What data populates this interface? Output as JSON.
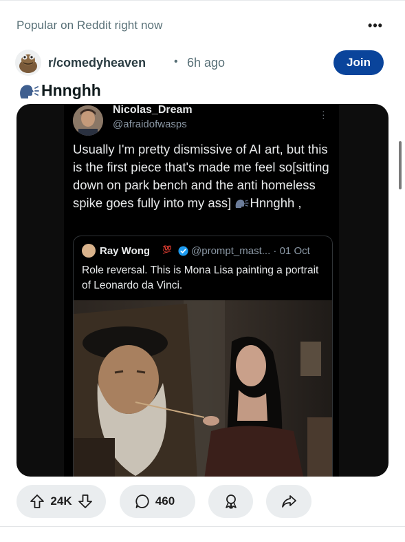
{
  "feed": {
    "section_title": "Popular on Reddit right now"
  },
  "post": {
    "subreddit": "r/comedyheaven",
    "separator": "•",
    "time_ago": "6h ago",
    "join_label": "Join",
    "title": "Hnnghh",
    "title_icon": "speaking-head-emoji"
  },
  "tweet": {
    "display_name": "Nicolas_Dream",
    "handle": "@afraidofwasps",
    "text_main": "Usually I'm pretty dismissive of AI art, but this is the first piece that's made me feel so[sitting down on park bench and the anti homeless spike goes fully into my ass] ",
    "text_tail": "Hnnghh ,",
    "quote": {
      "display_name": "Ray Wong",
      "emoji": "💯",
      "handle_and_date": "@prompt_mast... · 01 Oct",
      "text": "Role reversal. This is Mona Lisa painting a portrait of Leonardo da Vinci."
    }
  },
  "actions": {
    "vote_count": "24K",
    "comment_count": "460"
  },
  "colors": {
    "join_bg": "#0a449b",
    "pill_bg": "#eaedef",
    "verified": "#1d9bf0"
  }
}
